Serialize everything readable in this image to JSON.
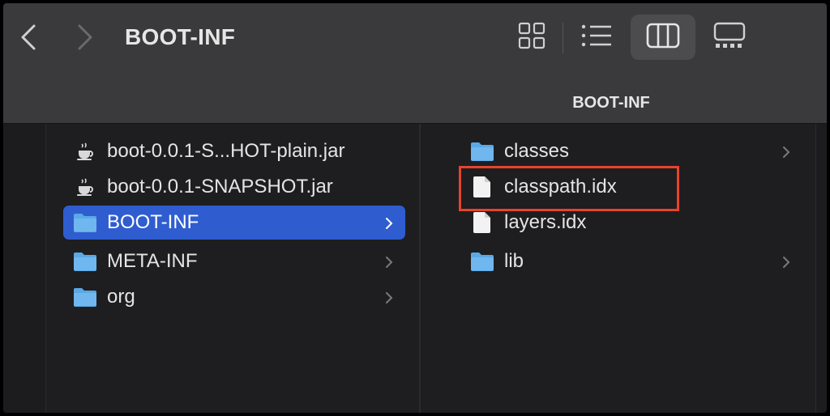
{
  "window": {
    "title": "BOOT-INF",
    "path_bar": "BOOT-INF"
  },
  "toolbar": {
    "back_icon": "chevron-left-icon",
    "forward_icon": "chevron-right-icon",
    "views": [
      {
        "name": "icon-view",
        "icon": "grid-icon",
        "active": false
      },
      {
        "name": "list-view",
        "icon": "list-icon",
        "active": false
      },
      {
        "name": "column-view",
        "icon": "columns-icon",
        "active": true
      },
      {
        "name": "gallery-view",
        "icon": "gallery-icon",
        "active": false
      }
    ]
  },
  "left_column": {
    "items": [
      {
        "label": "boot-0.0.1-S...HOT-plain.jar",
        "icon": "java-jar-icon",
        "has_children": false,
        "selected": false
      },
      {
        "label": "boot-0.0.1-SNAPSHOT.jar",
        "icon": "java-jar-icon",
        "has_children": false,
        "selected": false
      },
      {
        "label": "BOOT-INF",
        "icon": "folder-icon",
        "has_children": true,
        "selected": true
      },
      {
        "label": "META-INF",
        "icon": "folder-icon",
        "has_children": true,
        "selected": false
      },
      {
        "label": "org",
        "icon": "folder-icon",
        "has_children": true,
        "selected": false
      }
    ]
  },
  "right_column": {
    "items": [
      {
        "label": "classes",
        "icon": "folder-icon",
        "has_children": true
      },
      {
        "label": "classpath.idx",
        "icon": "file-icon",
        "has_children": false,
        "highlighted": true
      },
      {
        "label": "layers.idx",
        "icon": "file-icon",
        "has_children": false
      },
      {
        "label": "lib",
        "icon": "folder-icon",
        "has_children": true
      }
    ]
  },
  "colors": {
    "toolbar_bg": "#3a3a3c",
    "content_bg": "#1e1e20",
    "selection": "#2f5dd0",
    "folder": "#5aa9e6",
    "highlight_box": "#e8432c"
  }
}
